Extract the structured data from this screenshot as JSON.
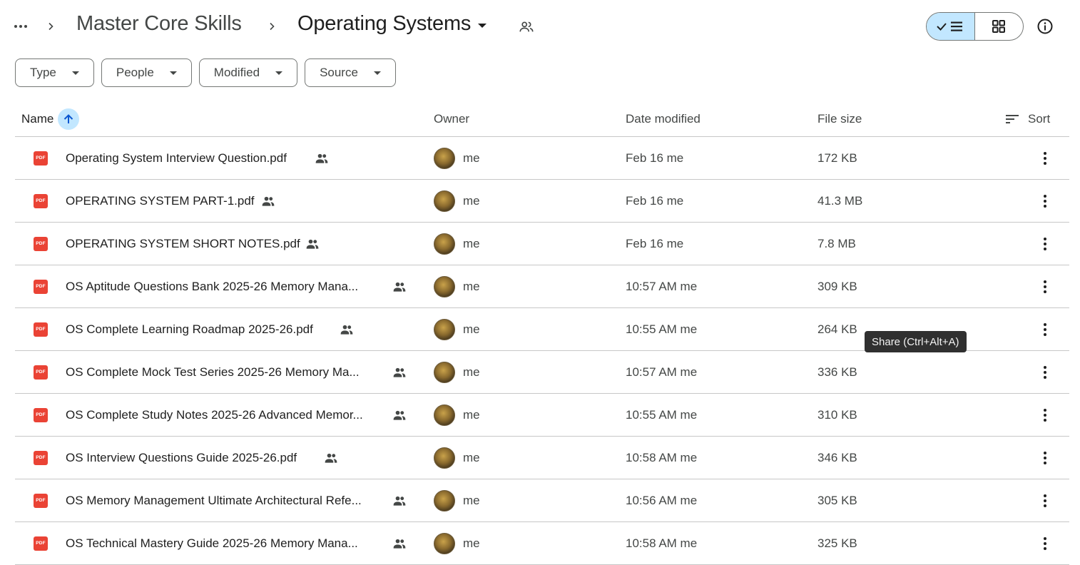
{
  "breadcrumb": {
    "parent": "Master Core Skills",
    "current": "Operating Systems"
  },
  "filters": [
    {
      "label": "Type"
    },
    {
      "label": "People"
    },
    {
      "label": "Modified"
    },
    {
      "label": "Source"
    }
  ],
  "columns": {
    "name": "Name",
    "owner": "Owner",
    "date": "Date modified",
    "size": "File size",
    "sort": "Sort"
  },
  "files": [
    {
      "name": "Operating System Interview Question.pdf",
      "owner": "me",
      "date": "Feb 16 me",
      "size": "172 KB"
    },
    {
      "name": "OPERATING SYSTEM PART-1.pdf",
      "owner": "me",
      "date": "Feb 16 me",
      "size": "41.3 MB"
    },
    {
      "name": "OPERATING SYSTEM SHORT NOTES.pdf",
      "owner": "me",
      "date": "Feb 16 me",
      "size": "7.8 MB"
    },
    {
      "name": "OS Aptitude Questions Bank 2025-26 Memory Mana...",
      "owner": "me",
      "date": "10:57 AM me",
      "size": "309 KB"
    },
    {
      "name": "OS Complete Learning Roadmap 2025-26.pdf",
      "owner": "me",
      "date": "10:55 AM me",
      "size": "264 KB"
    },
    {
      "name": "OS Complete Mock Test Series 2025-26 Memory Ma...",
      "owner": "me",
      "date": "10:57 AM me",
      "size": "336 KB"
    },
    {
      "name": "OS Complete Study Notes 2025-26 Advanced Memor...",
      "owner": "me",
      "date": "10:55 AM me",
      "size": "310 KB"
    },
    {
      "name": "OS Interview Questions Guide 2025-26.pdf",
      "owner": "me",
      "date": "10:58 AM me",
      "size": "346 KB"
    },
    {
      "name": "OS Memory Management Ultimate Architectural Refe...",
      "owner": "me",
      "date": "10:56 AM me",
      "size": "305 KB"
    },
    {
      "name": "OS Technical Mastery Guide 2025-26 Memory Mana...",
      "owner": "me",
      "date": "10:58 AM me",
      "size": "325 KB"
    }
  ],
  "file_icon_label": "PDF",
  "tooltip": "Share (Ctrl+Alt+A)",
  "icons": {
    "more": "more-horiz-icon",
    "chevron": "chevron-right-icon",
    "shared_folder": "people-outline-icon",
    "list_view": "checked-list-icon",
    "grid_view": "grid-icon",
    "info": "info-icon",
    "sort_arrow": "arrow-up-icon",
    "sort": "sort-lines-icon",
    "shared": "people-icon",
    "row_more": "more-vert-icon"
  },
  "colors": {
    "accent": "#c2e7ff",
    "pdf_red": "#ea4335",
    "tooltip_bg": "#303030"
  }
}
